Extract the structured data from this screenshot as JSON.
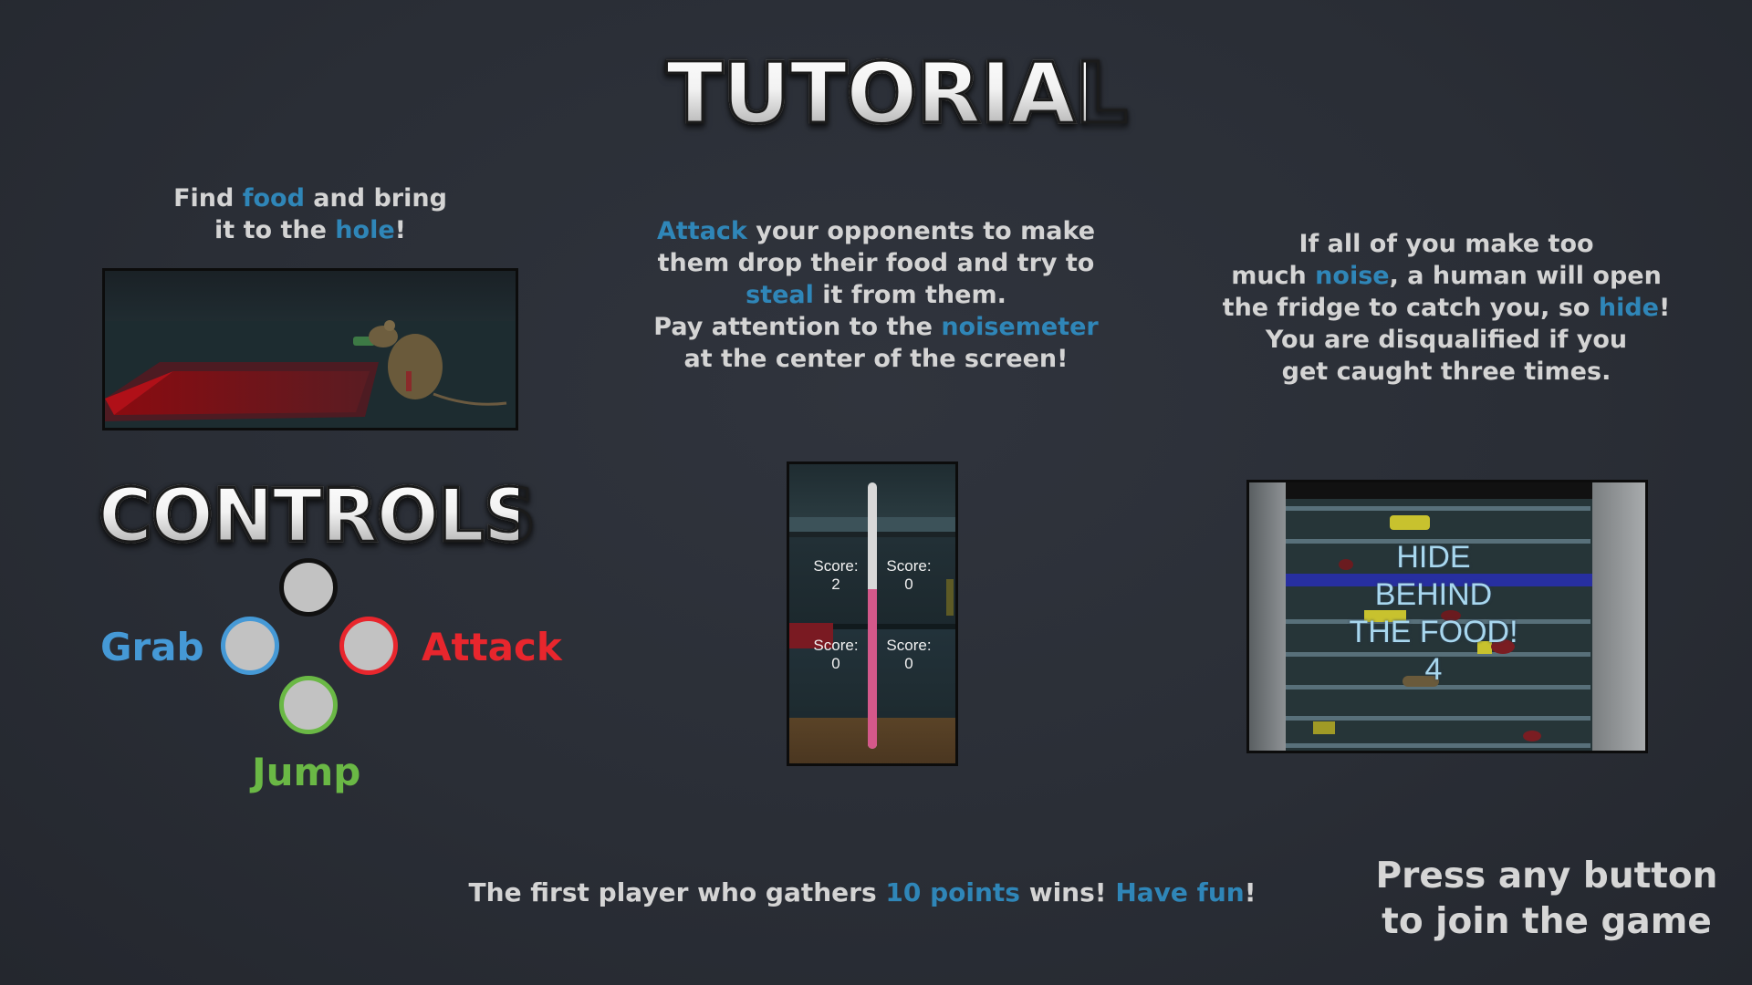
{
  "title": "TUTORIAL",
  "controls_title": "CONTROLS",
  "section_food": {
    "parts": [
      "Find ",
      "food",
      " and bring",
      "it to the ",
      "hole",
      "!"
    ]
  },
  "section_attack": {
    "parts": [
      "Attack",
      " your opponents to make",
      "them drop their food and try to",
      "steal",
      " it from them.",
      "Pay attention to the ",
      "noisemeter",
      "at the center of the screen!"
    ]
  },
  "section_hide": {
    "parts": [
      "If all of you make too",
      "much ",
      "noise",
      ", a human will open",
      "the fridge to catch you, so ",
      "hide",
      "!",
      "You are disqualified if you",
      "get caught three times."
    ]
  },
  "controls": {
    "grab": "Grab",
    "attack": "Attack",
    "jump": "Jump",
    "colors": {
      "grab": "#4599d6",
      "attack": "#e8262d",
      "jump": "#6ab845",
      "top": "#111111"
    }
  },
  "noisemeter_preview": {
    "scores": [
      {
        "label": "Score:",
        "value": "2"
      },
      {
        "label": "Score:",
        "value": "0"
      },
      {
        "label": "Score:",
        "value": "0"
      },
      {
        "label": "Score:",
        "value": "0"
      }
    ],
    "noise_level": 0.6
  },
  "fridge_preview": {
    "line1": "HIDE",
    "line2": "BEHIND",
    "line3": "THE FOOD!",
    "countdown": "4"
  },
  "footer": {
    "parts": [
      "The first player who gathers ",
      "10 points",
      " wins! ",
      "Have fun",
      "!"
    ]
  },
  "join_prompt": {
    "line1": "Press any button",
    "line2": "to join the game"
  },
  "accent_color": "#2f86b8"
}
